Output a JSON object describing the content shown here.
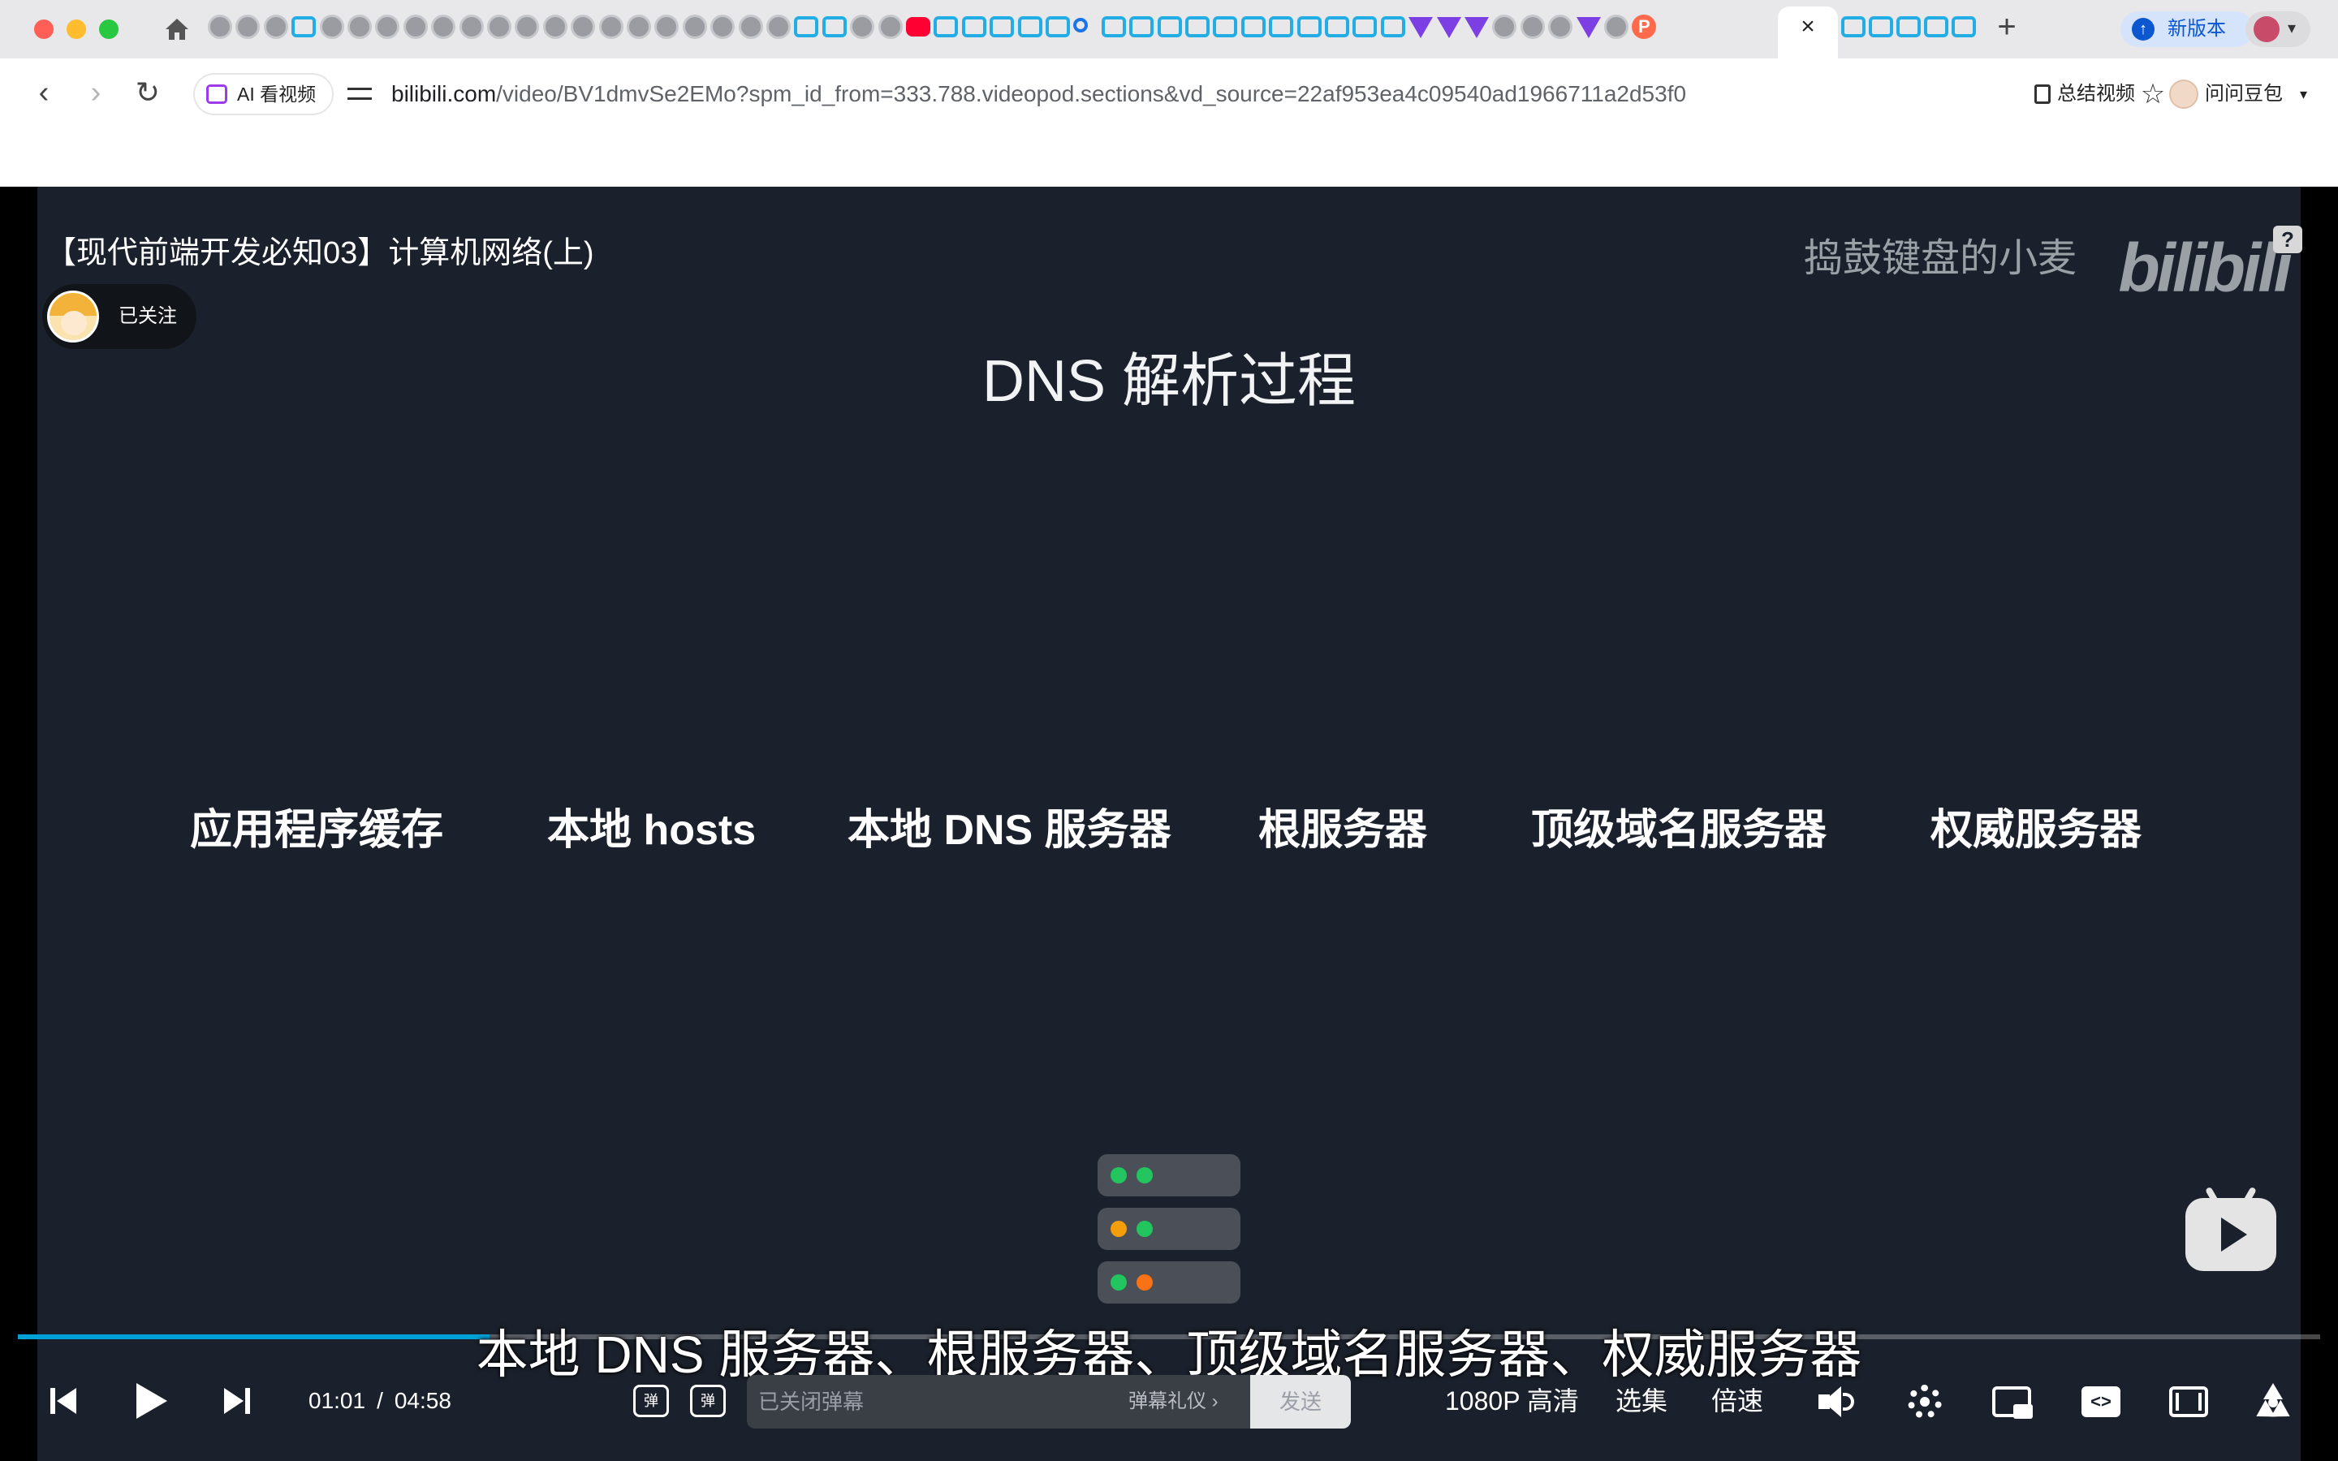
{
  "browser": {
    "tab_favicons": [
      "globe",
      "globe",
      "globe",
      "bili",
      "globe",
      "globe",
      "globe",
      "globe",
      "globe",
      "globe",
      "globe",
      "globe",
      "globe",
      "globe",
      "globe",
      "globe",
      "globe",
      "globe",
      "globe",
      "globe",
      "globe",
      "bili",
      "bili",
      "globe",
      "globe",
      "yt",
      "bili",
      "bili",
      "bili",
      "bili",
      "bili",
      "search",
      "bili",
      "bili",
      "bili",
      "bili",
      "bili",
      "bili",
      "bili",
      "bili",
      "bili",
      "bili",
      "bili",
      "vue",
      "vue",
      "vue",
      "globe",
      "globe",
      "globe",
      "vue",
      "globe",
      "pbadge"
    ],
    "tab_favicon_badge_text": "P",
    "active_tab_close": "×",
    "tabs_after_active": [
      "bili",
      "bili",
      "bili",
      "bili",
      "bili"
    ],
    "new_tab_label": "+",
    "new_version_label": "新版本",
    "address": {
      "ai_chip_label": "AI 看视频",
      "url_host": "bilibili.com",
      "url_rest": "/video/BV1dmvSe2EMo?spm_id_from=333.788.videopod.sections&vd_source=22af953ea4c09540ad1966711a2d53f0"
    },
    "summary_label": "总结视频",
    "account_label": "问问豆包"
  },
  "video": {
    "title": "【现代前端开发必知03】计算机网络(上)",
    "follow_label": "已关注",
    "watermark_text": "捣鼓键盘的小麦",
    "logo_text": "bilibili",
    "help_label": "?",
    "slide": {
      "heading": "DNS 解析过程",
      "steps": [
        "应用程序缓存",
        "本地 hosts",
        "本地 DNS 服务器",
        "根服务器",
        "顶级域名服务器",
        "权威服务器"
      ],
      "server_leds": [
        [
          "#22c55e",
          "#22c55e"
        ],
        [
          "#f59e0b",
          "#22c55e"
        ],
        [
          "#22c55e",
          "#f97316"
        ]
      ]
    },
    "subtitle": "本地 DNS 服务器、根服务器、顶级域名服务器、权威服务器",
    "progress_fraction": 0.205,
    "accent_color": "#00a1d6"
  },
  "controls": {
    "current_time": "01:01",
    "separator": "/",
    "duration": "04:58",
    "danmaku_toggle_label": "弹",
    "danmaku_settings_label": "弹",
    "danmaku_placeholder": "已关闭弹幕",
    "danmaku_etiquette": "弹幕礼仪 ›",
    "send_label": "发送",
    "quality_label": "1080P 高清",
    "episodes_label": "选集",
    "speed_label": "倍速",
    "wide_label": "<>"
  }
}
